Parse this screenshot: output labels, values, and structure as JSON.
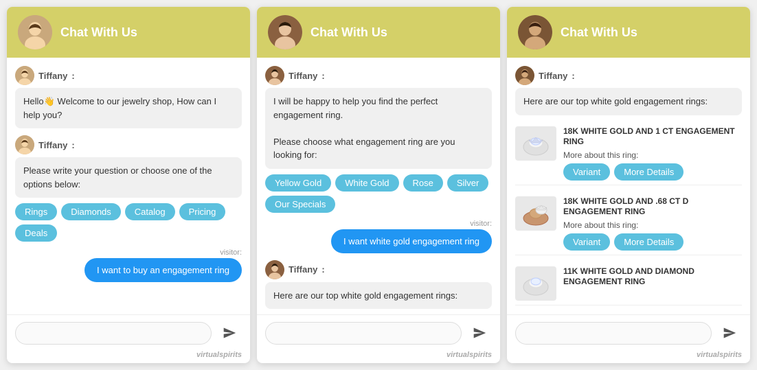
{
  "widgets": [
    {
      "id": "widget1",
      "header": {
        "title": "Chat With Us"
      },
      "messages": [
        {
          "type": "agent",
          "agent": "Tiffany",
          "text": "Hello👋 Welcome to our jewelry shop, How can I help you?"
        },
        {
          "type": "agent",
          "agent": "Tiffany",
          "text": "Please write your question or choose one of the options below:",
          "options": [
            "Rings",
            "Diamonds",
            "Catalog",
            "Pricing",
            "Deals"
          ]
        },
        {
          "type": "visitor",
          "label": "visitor:",
          "text": "I want to buy an engagement ring"
        }
      ],
      "input_placeholder": "",
      "branding": "virtual",
      "branding_bold": "spirits"
    },
    {
      "id": "widget2",
      "header": {
        "title": "Chat With Us"
      },
      "messages": [
        {
          "type": "agent",
          "agent": "Tiffany",
          "text": "I will be happy to help you find the perfect engagement ring.\n\nPlease choose what engagement ring are you looking for:",
          "options": [
            "Yellow Gold",
            "White Gold",
            "Rose",
            "Silver",
            "Our Specials"
          ]
        },
        {
          "type": "visitor",
          "label": "visitor:",
          "text": "I want white gold engagement ring"
        },
        {
          "type": "agent",
          "agent": "Tiffany",
          "text": "Here are our top white gold engagement rings:"
        }
      ],
      "input_placeholder": "",
      "branding": "virtual",
      "branding_bold": "spirits"
    },
    {
      "id": "widget3",
      "header": {
        "title": "Chat With Us"
      },
      "messages": [
        {
          "type": "agent",
          "agent": "Tiffany",
          "text": "Here are our top white gold engagement rings:"
        },
        {
          "type": "products",
          "items": [
            {
              "name": "18K WHITE GOLD AND 1 CT ENGAGEMENT RING",
              "sub": "More about this ring:",
              "btns": [
                "Variant",
                "More Details"
              ],
              "img_color": "#d0d0d0"
            },
            {
              "name": "18K WHITE GOLD AND .68 CT D ENGAGEMENT RING",
              "sub": "More about this ring:",
              "btns": [
                "Variant",
                "More Details"
              ],
              "img_color": "#c8a86e"
            },
            {
              "name": "11K WHITE GOLD AND DIAMOND ENGAGEMENT RING",
              "sub": "",
              "btns": [],
              "img_color": "#d0d0d0"
            }
          ]
        }
      ],
      "input_placeholder": "",
      "branding": "virtual",
      "branding_bold": "spirits"
    }
  ]
}
